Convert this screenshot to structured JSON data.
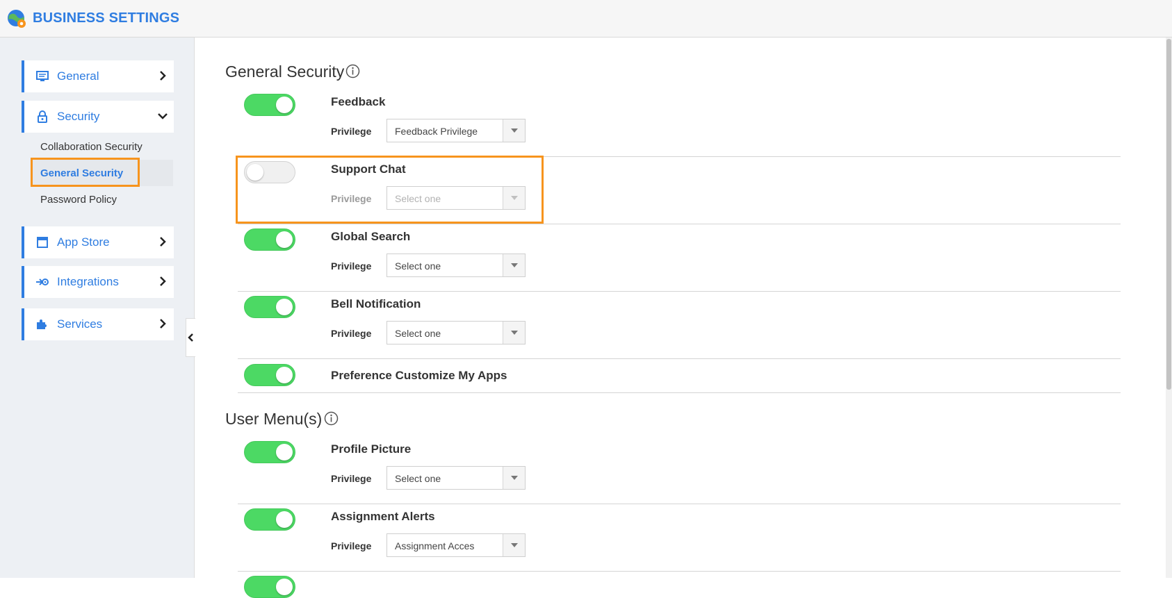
{
  "app": {
    "title": "BUSINESS SETTINGS",
    "accent": "#2f7de1",
    "highlight": "#f7941d",
    "toggle_on": "#4cd964"
  },
  "sidebar": {
    "general": {
      "label": "General",
      "icon": "monitor-icon"
    },
    "security": {
      "label": "Security",
      "icon": "lock-icon",
      "expanded": true,
      "sub_items": [
        "Collaboration Security",
        "General Security",
        "Password Policy"
      ],
      "active": "General Security"
    },
    "app_store": {
      "label": "App Store",
      "icon": "store-icon"
    },
    "integrations": {
      "label": "Integrations",
      "icon": "integrations-icon"
    },
    "services": {
      "label": "Services",
      "icon": "puzzle-icon"
    }
  },
  "sections": {
    "general_security": {
      "title": "General Security"
    },
    "user_menus": {
      "title": "User Menu(s)"
    }
  },
  "privilege_label": "Privilege",
  "features": {
    "feedback": {
      "name": "Feedback",
      "enabled": true,
      "privilege": "Feedback Privilege"
    },
    "support_chat": {
      "name": "Support Chat",
      "enabled": false,
      "privilege": "Select one"
    },
    "global_search": {
      "name": "Global Search",
      "enabled": true,
      "privilege": "Select one"
    },
    "bell_notification": {
      "name": "Bell Notification",
      "enabled": true,
      "privilege": "Select one"
    },
    "preference_customize": {
      "name": "Preference Customize My Apps",
      "enabled": true
    },
    "profile_picture": {
      "name": "Profile Picture",
      "enabled": true,
      "privilege": "Select one"
    },
    "assignment_alerts": {
      "name": "Assignment Alerts",
      "enabled": true,
      "privilege": "Assignment Acces"
    }
  }
}
